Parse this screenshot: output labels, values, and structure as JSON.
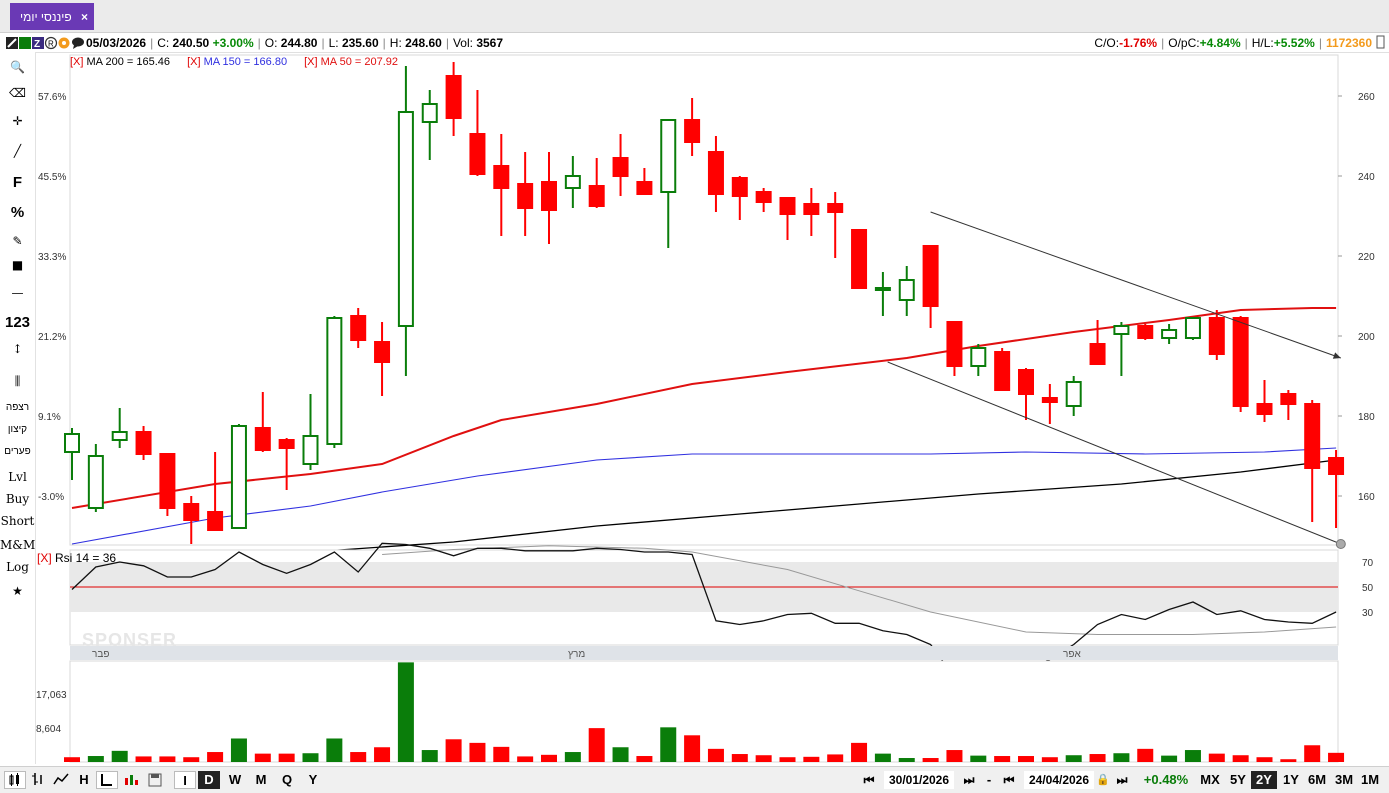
{
  "tab": {
    "label": "פיננסי יומי",
    "close": "×"
  },
  "info": {
    "date": "05/03/2026",
    "close_label": "C:",
    "close": "240.50",
    "change": "+3.00%",
    "open_label": "O:",
    "open": "244.80",
    "low_label": "L:",
    "low": "235.60",
    "high_label": "H:",
    "high": "248.60",
    "vol_label": "Vol:",
    "vol": "3567",
    "co_label": "C/O:",
    "co": "-1.76%",
    "opc_label": "O/pC:",
    "opc": "+4.84%",
    "hl_label": "H/L:",
    "hl": "+5.52%",
    "code": "1172360"
  },
  "legend": {
    "ma200": "MA 200 = 165.46",
    "ma150": "MA 150 = 166.80",
    "ma50": "MA 50 = 207.92",
    "x": "[X]"
  },
  "rsi_label": "Rsi 14 = 36",
  "sponser": "SPONSER",
  "left_tools": [
    {
      "name": "search-icon",
      "label": "🔍"
    },
    {
      "name": "eraser-icon",
      "label": "⌫"
    },
    {
      "name": "crosshair-icon",
      "label": "✛"
    },
    {
      "name": "line-tool-icon",
      "label": "╱"
    },
    {
      "name": "fibonacci-tool",
      "label": "F"
    },
    {
      "name": "percent-tool",
      "label": "%"
    },
    {
      "name": "edit-icon",
      "label": "✎"
    },
    {
      "name": "color-swatch-icon",
      "label": "■"
    },
    {
      "name": "horizontal-line-icon",
      "label": "—"
    },
    {
      "name": "number-tool",
      "label": "123"
    },
    {
      "name": "vertical-measure-icon",
      "label": "↕"
    },
    {
      "name": "candles-icon",
      "label": "⫼"
    },
    {
      "name": "tool-floor",
      "label": "רצפה"
    },
    {
      "name": "tool-ceiling",
      "label": "קיצון"
    },
    {
      "name": "tool-gaps",
      "label": "פערים"
    },
    {
      "name": "tool-lvl",
      "label": "Lvl"
    },
    {
      "name": "tool-buy",
      "label": "Buy"
    },
    {
      "name": "tool-short",
      "label": "Short"
    },
    {
      "name": "tool-mm",
      "label": "M&M"
    },
    {
      "name": "tool-log",
      "label": "Log"
    },
    {
      "name": "star-icon",
      "label": "★"
    }
  ],
  "bottom": {
    "intervals": [
      "I",
      "D",
      "W",
      "M",
      "Q",
      "Y"
    ],
    "active_interval": "D",
    "from_date": "30/01/2026",
    "to_date": "24/04/2026",
    "period_change": "+0.48%",
    "ranges": [
      "MX",
      "5Y",
      "2Y",
      "1Y",
      "6M",
      "3M",
      "1M"
    ],
    "active_range": "2Y"
  },
  "colors": {
    "up": "#0a7d0a",
    "down": "#ff0000",
    "ma50": "#e01010",
    "ma150": "#3030e0",
    "ma200": "#000000",
    "accent": "#6a39b5"
  },
  "chart_data": {
    "type": "candlestick",
    "price_ticks_right": [
      160,
      180,
      200,
      220,
      240,
      260
    ],
    "pct_ticks_left": [
      "-3.0%",
      "9.1%",
      "21.2%",
      "33.3%",
      "45.5%",
      "57.6%"
    ],
    "month_labels": [
      "פבר",
      "מרץ",
      "אפר"
    ],
    "volume_ticks": [
      "8,604",
      "17,063"
    ],
    "rsi_ticks": [
      30,
      50,
      70
    ],
    "candles": [
      {
        "o": 171,
        "h": 177,
        "l": 164,
        "c": 175.5
      },
      {
        "o": 157,
        "h": 173,
        "l": 156,
        "c": 170
      },
      {
        "o": 174,
        "h": 182,
        "l": 172,
        "c": 176
      },
      {
        "o": 176,
        "h": 177.5,
        "l": 169,
        "c": 170.5
      },
      {
        "o": 170.5,
        "h": 170.5,
        "l": 155,
        "c": 157
      },
      {
        "o": 158,
        "h": 160,
        "l": 148,
        "c": 154
      },
      {
        "o": 156,
        "h": 171,
        "l": 152.5,
        "c": 151.5
      },
      {
        "o": 152,
        "h": 178,
        "l": 153,
        "c": 177.5
      },
      {
        "o": 177,
        "h": 186,
        "l": 171,
        "c": 171.5
      },
      {
        "o": 174,
        "h": 174.5,
        "l": 161.5,
        "c": 172
      },
      {
        "o": 168,
        "h": 185.5,
        "l": 166.5,
        "c": 175
      },
      {
        "o": 173,
        "h": 205,
        "l": 172,
        "c": 204.5
      },
      {
        "o": 205,
        "h": 207,
        "l": 197,
        "c": 199
      },
      {
        "o": 198.5,
        "h": 203.5,
        "l": 185,
        "c": 193.5
      },
      {
        "o": 202.5,
        "h": 267.5,
        "l": 190,
        "c": 256
      },
      {
        "o": 253.5,
        "h": 261.5,
        "l": 244,
        "c": 258
      },
      {
        "o": 265,
        "h": 268.5,
        "l": 250,
        "c": 254.5
      },
      {
        "o": 250.5,
        "h": 261.5,
        "l": 240,
        "c": 240.5
      },
      {
        "o": 242.5,
        "h": 250.5,
        "l": 225,
        "c": 237
      },
      {
        "o": 238,
        "h": 246,
        "l": 225,
        "c": 232
      },
      {
        "o": 238.5,
        "h": 246,
        "l": 223,
        "c": 231.5
      },
      {
        "o": 237,
        "h": 245,
        "l": 232,
        "c": 240
      },
      {
        "o": 237.5,
        "h": 244.5,
        "l": 232,
        "c": 232.5
      },
      {
        "o": 244.5,
        "h": 250.5,
        "l": 235,
        "c": 240
      },
      {
        "o": 238.5,
        "h": 242,
        "l": 236,
        "c": 235.5
      },
      {
        "o": 236,
        "h": 250,
        "l": 222,
        "c": 254
      },
      {
        "o": 254,
        "h": 259.5,
        "l": 245,
        "c": 248.5
      },
      {
        "o": 246,
        "h": 250,
        "l": 231,
        "c": 235.5
      },
      {
        "o": 239.5,
        "h": 240,
        "l": 229,
        "c": 235
      },
      {
        "o": 236,
        "h": 237,
        "l": 231,
        "c": 233.5
      },
      {
        "o": 234.5,
        "h": 234.5,
        "l": 224,
        "c": 230.5
      },
      {
        "o": 233,
        "h": 237,
        "l": 225,
        "c": 230.5
      },
      {
        "o": 233,
        "h": 236,
        "l": 219.5,
        "c": 231
      },
      {
        "o": 226.5,
        "h": 226.5,
        "l": 221,
        "c": 212
      },
      {
        "o": 212,
        "h": 216,
        "l": 205,
        "c": 212
      },
      {
        "o": 209,
        "h": 217.5,
        "l": 205,
        "c": 214
      },
      {
        "o": 222.5,
        "h": 222.5,
        "l": 202,
        "c": 207.5
      },
      {
        "o": 203.5,
        "h": 203.5,
        "l": 190,
        "c": 192.5
      },
      {
        "o": 192.5,
        "h": 198,
        "l": 190,
        "c": 197
      },
      {
        "o": 196,
        "h": 197,
        "l": 186.5,
        "c": 186.5
      },
      {
        "o": 191.5,
        "h": 192,
        "l": 179,
        "c": 185.5
      },
      {
        "o": 184.5,
        "h": 188,
        "l": 178,
        "c": 183.5
      },
      {
        "o": 182.5,
        "h": 190,
        "l": 180,
        "c": 188.5
      },
      {
        "o": 198,
        "h": 204,
        "l": 193,
        "c": 193
      },
      {
        "o": 200.5,
        "h": 203.5,
        "l": 190,
        "c": 202.5
      },
      {
        "o": 202.5,
        "h": 203,
        "l": 199,
        "c": 199.5
      },
      {
        "o": 199.5,
        "h": 203,
        "l": 198,
        "c": 201.5
      },
      {
        "o": 199.5,
        "h": 204,
        "l": 199,
        "c": 204.5
      },
      {
        "o": 204.5,
        "h": 206.5,
        "l": 194,
        "c": 195.5
      },
      {
        "o": 204.5,
        "h": 205,
        "l": 181,
        "c": 182.5
      },
      {
        "o": 183,
        "h": 189,
        "l": 178.5,
        "c": 180.5
      },
      {
        "o": 185.5,
        "h": 186.5,
        "l": 179,
        "c": 183
      },
      {
        "o": 183,
        "h": 184,
        "l": 153.5,
        "c": 167
      },
      {
        "o": 169.5,
        "h": 171.5,
        "l": 152,
        "c": 165.5
      }
    ],
    "volumes": [
      {
        "v": 1200,
        "up": false
      },
      {
        "v": 1500,
        "up": true
      },
      {
        "v": 2800,
        "up": true
      },
      {
        "v": 1400,
        "up": false
      },
      {
        "v": 1400,
        "up": false
      },
      {
        "v": 1200,
        "up": false
      },
      {
        "v": 2500,
        "up": false
      },
      {
        "v": 5900,
        "up": true
      },
      {
        "v": 2100,
        "up": false
      },
      {
        "v": 2100,
        "up": false
      },
      {
        "v": 2200,
        "up": true
      },
      {
        "v": 5900,
        "up": true
      },
      {
        "v": 2500,
        "up": false
      },
      {
        "v": 3700,
        "up": false
      },
      {
        "v": 25000,
        "up": true
      },
      {
        "v": 3000,
        "up": true
      },
      {
        "v": 5700,
        "up": false
      },
      {
        "v": 4800,
        "up": false
      },
      {
        "v": 3800,
        "up": false
      },
      {
        "v": 1400,
        "up": false
      },
      {
        "v": 1800,
        "up": false
      },
      {
        "v": 2500,
        "up": true
      },
      {
        "v": 8500,
        "up": false
      },
      {
        "v": 3700,
        "up": true
      },
      {
        "v": 1500,
        "up": false
      },
      {
        "v": 8700,
        "up": true
      },
      {
        "v": 6700,
        "up": false
      },
      {
        "v": 3300,
        "up": false
      },
      {
        "v": 2000,
        "up": false
      },
      {
        "v": 1700,
        "up": false
      },
      {
        "v": 1200,
        "up": false
      },
      {
        "v": 1300,
        "up": false
      },
      {
        "v": 1900,
        "up": false
      },
      {
        "v": 4800,
        "up": false
      },
      {
        "v": 2100,
        "up": true
      },
      {
        "v": 1000,
        "up": true
      },
      {
        "v": 1000,
        "up": false
      },
      {
        "v": 3000,
        "up": false
      },
      {
        "v": 1600,
        "up": true
      },
      {
        "v": 1500,
        "up": false
      },
      {
        "v": 1500,
        "up": false
      },
      {
        "v": 1200,
        "up": false
      },
      {
        "v": 1700,
        "up": true
      },
      {
        "v": 2000,
        "up": false
      },
      {
        "v": 2200,
        "up": true
      },
      {
        "v": 3300,
        "up": false
      },
      {
        "v": 1600,
        "up": true
      },
      {
        "v": 3000,
        "up": true
      },
      {
        "v": 2100,
        "up": false
      },
      {
        "v": 1700,
        "up": false
      },
      {
        "v": 1200,
        "up": false
      },
      {
        "v": 700,
        "up": false
      },
      {
        "v": 4200,
        "up": false
      },
      {
        "v": 2300,
        "up": false
      }
    ],
    "ma50": [
      [
        0,
        157
      ],
      [
        6,
        163
      ],
      [
        10,
        165.5
      ],
      [
        13,
        168
      ],
      [
        16,
        175
      ],
      [
        18,
        179
      ],
      [
        22,
        183
      ],
      [
        26,
        188
      ],
      [
        30,
        191
      ],
      [
        35,
        194.5
      ],
      [
        38,
        197.5
      ],
      [
        42,
        201
      ],
      [
        46,
        204
      ],
      [
        49,
        206.5
      ],
      [
        52,
        207
      ],
      [
        53,
        207
      ]
    ],
    "ma150": [
      [
        0,
        148
      ],
      [
        6,
        154.5
      ],
      [
        10,
        157.5
      ],
      [
        13,
        161
      ],
      [
        17,
        165
      ],
      [
        22,
        169
      ],
      [
        26,
        170.5
      ],
      [
        30,
        170.5
      ],
      [
        36,
        170.5
      ],
      [
        40,
        171
      ],
      [
        45,
        170.5
      ],
      [
        50,
        171
      ],
      [
        53,
        172
      ]
    ],
    "ma200": [
      [
        0,
        143.5
      ],
      [
        10,
        146
      ],
      [
        16,
        148.5
      ],
      [
        22,
        152.5
      ],
      [
        28,
        155.5
      ],
      [
        33,
        158
      ],
      [
        38,
        160.5
      ],
      [
        44,
        163
      ],
      [
        49,
        166
      ],
      [
        53,
        169
      ]
    ],
    "rsi": [
      [
        0,
        48
      ],
      [
        1,
        66
      ],
      [
        2,
        70
      ],
      [
        3,
        67
      ],
      [
        4,
        58
      ],
      [
        5,
        58
      ],
      [
        6,
        64
      ],
      [
        7,
        78
      ],
      [
        8,
        68
      ],
      [
        9,
        61
      ],
      [
        10,
        68
      ],
      [
        11,
        78
      ],
      [
        12,
        62
      ],
      [
        13,
        85
      ],
      [
        14,
        84
      ],
      [
        15,
        81
      ],
      [
        16,
        75
      ],
      [
        17,
        81
      ],
      [
        18,
        81
      ],
      [
        19,
        79
      ],
      [
        20,
        79
      ],
      [
        21,
        79
      ],
      [
        22,
        81
      ],
      [
        23,
        80
      ],
      [
        24,
        78
      ],
      [
        25,
        78
      ],
      [
        26,
        76
      ],
      [
        27,
        23
      ],
      [
        28,
        20
      ],
      [
        29,
        23
      ],
      [
        30,
        28
      ],
      [
        31,
        29
      ],
      [
        32,
        21
      ],
      [
        33,
        21
      ],
      [
        34,
        15
      ],
      [
        35,
        12
      ],
      [
        36,
        4
      ],
      [
        37,
        -22
      ],
      [
        38,
        -17
      ],
      [
        39,
        -22
      ],
      [
        40,
        -16
      ],
      [
        41,
        -8
      ],
      [
        42,
        4
      ],
      [
        43,
        20
      ],
      [
        44,
        28
      ],
      [
        45,
        24
      ],
      [
        46,
        32
      ],
      [
        47,
        38
      ],
      [
        48,
        28
      ],
      [
        49,
        31
      ],
      [
        50,
        24
      ],
      [
        51,
        22
      ],
      [
        52,
        21
      ],
      [
        53,
        30
      ]
    ],
    "rsi_signal": [
      [
        13,
        76
      ],
      [
        16,
        80
      ],
      [
        20,
        83
      ],
      [
        24,
        81
      ],
      [
        26,
        78
      ],
      [
        30,
        64
      ],
      [
        33,
        47
      ],
      [
        36,
        30
      ],
      [
        40,
        14
      ],
      [
        43,
        12
      ],
      [
        47,
        12
      ],
      [
        50,
        14
      ],
      [
        53,
        18
      ]
    ],
    "trendlines": [
      {
        "from": [
          36,
          231
        ],
        "to": [
          53.2,
          194.5
        ],
        "arrow": true
      },
      {
        "from": [
          34.2,
          193.5
        ],
        "to": [
          53.2,
          148
        ],
        "arrow": false
      }
    ]
  }
}
